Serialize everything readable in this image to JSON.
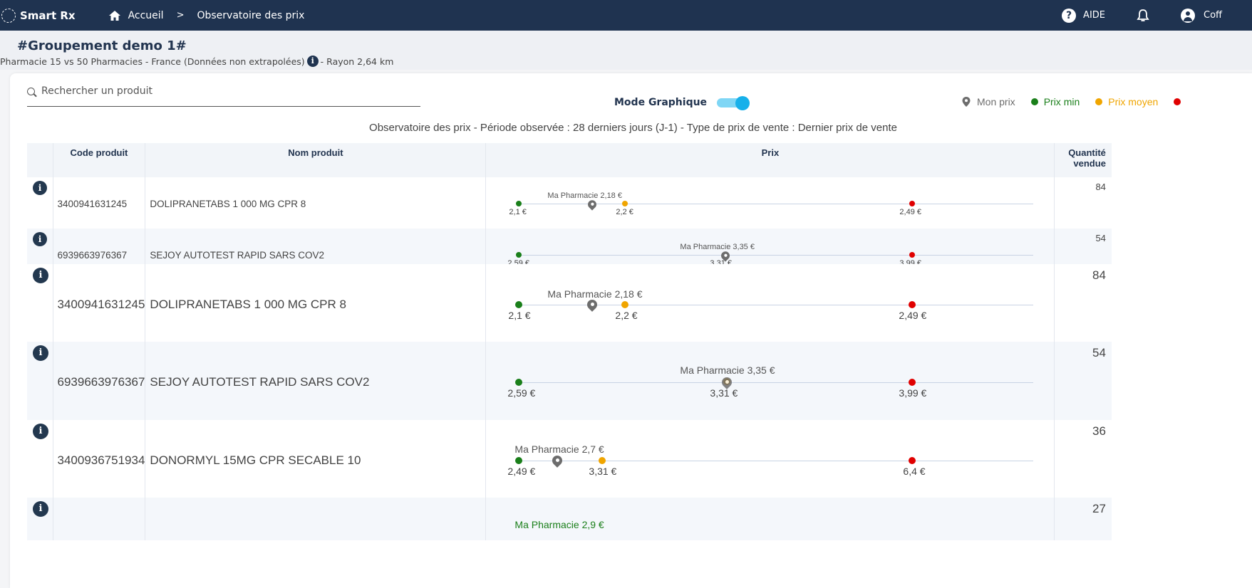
{
  "nav": {
    "brand": "Smart Rx",
    "home": "Accueil",
    "separator": ">",
    "current": "Observatoire des prix",
    "help": "AIDE",
    "user": "Coff"
  },
  "group": {
    "title": "#Groupement demo 1#",
    "subtitle": "Pharmacie 15 vs 50 Pharmacies - France (Données non extrapolées)",
    "radius": "- Rayon 2,64 km"
  },
  "search": {
    "placeholder": "Rechercher un produit"
  },
  "mode": {
    "label": "Mode Graphique",
    "enabled": true
  },
  "legend": [
    {
      "label": "Mon prix",
      "color": "#6d6d6d"
    },
    {
      "label": "Prix min",
      "color": "#1a7f1a"
    },
    {
      "label": "Prix moyen",
      "color": "#f0a500"
    }
  ],
  "observation": "Observatoire des prix - Période observée : 28 derniers jours (J-1) - Type de prix de vente : Dernier prix de vente",
  "table": {
    "headers": {
      "code": "Code produit",
      "name": "Nom produit",
      "price": "Prix",
      "qty_line1": "Quantité",
      "qty_line2": "vendue"
    },
    "rows": [
      {
        "code": "3400941631245",
        "name": "DOLIPRANETABS 1 000 MG CPR 8",
        "qty": "84",
        "my_label": "Ma Pharmacie 2,18 €",
        "min": "2,1 €",
        "avg": "2,2 €",
        "max": "2,49 €"
      },
      {
        "code": "6939663976367",
        "name": "SEJOY AUTOTEST RAPID SARS COV2",
        "qty": "54",
        "my_label": "Ma Pharmacie 3,35 €",
        "min": "2,59 €",
        "avg": "3,31 €",
        "max": "3,99 €"
      },
      {
        "code": "3400941631245",
        "name": "DOLIPRANETABS 1 000 MG CPR 8",
        "qty": "84",
        "my_label": "Ma Pharmacie 2,18 €",
        "min": "2,1 €",
        "avg": "2,2 €",
        "max": "2,49 €"
      },
      {
        "code": "6939663976367",
        "name": "SEJOY AUTOTEST RAPID SARS COV2",
        "qty": "54",
        "my_label": "Ma Pharmacie 3,35 €",
        "min": "2,59 €",
        "avg": "3,31 €",
        "max": "3,99 €"
      },
      {
        "code": "3400936751934",
        "name": "DONORMYL 15MG CPR SECABLE 10",
        "qty": "36",
        "my_label": "Ma Pharmacie 2,7 €",
        "min": "2,49 €",
        "avg": "3,31 €",
        "max": "6,4 €"
      },
      {
        "code": "",
        "name": "",
        "qty": "27",
        "my_label": "Ma Pharmacie 2,9 €",
        "min": "",
        "avg": "",
        "max": ""
      }
    ]
  }
}
